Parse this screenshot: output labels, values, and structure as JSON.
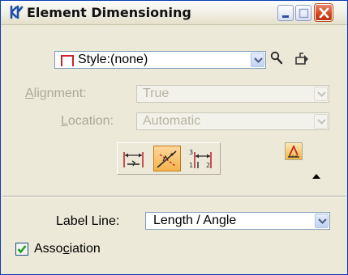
{
  "window": {
    "title": "Element Dimensioning",
    "icons": {
      "app": "dimension-tool-icon",
      "minimize": "minimize-icon",
      "maximize": "maximize-icon",
      "close": "close-icon"
    }
  },
  "style": {
    "value": "Style:(none)",
    "icons": {
      "style": "dimension-style-icon",
      "search": "magnifier-icon",
      "manage": "style-manager-icon"
    }
  },
  "alignment": {
    "label_pre": "",
    "label_mnemonic": "A",
    "label_post": "lignment:",
    "value": "True"
  },
  "location": {
    "label_pre": "",
    "label_mnemonic": "L",
    "label_post": "ocation:",
    "value": "Automatic"
  },
  "tools": [
    {
      "name": "dimension-size-arrow-icon",
      "active": false
    },
    {
      "name": "dimension-angle-icon",
      "active": true
    },
    {
      "name": "dimension-ordinate-icon",
      "active": false
    }
  ],
  "toolsettings_icon": "dimension-settings-icon",
  "collapse_icon": "triangle-up-icon",
  "label_line": {
    "label": "Label Line:",
    "value": "Length / Angle"
  },
  "association": {
    "label_pre": "Asso",
    "label_mnemonic": "c",
    "label_post": "iation",
    "checked": true
  },
  "colors": {
    "accent": "#f7b34b",
    "title_text": "#111111",
    "disabled_text": "#aca899",
    "close_red": "#d1461c"
  }
}
